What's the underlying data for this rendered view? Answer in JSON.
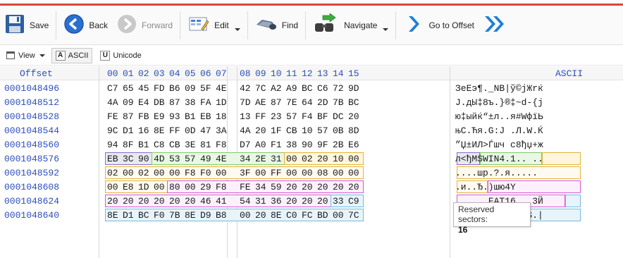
{
  "toolbar": {
    "save_label": "Save",
    "back_label": "Back",
    "forward_label": "Forward",
    "edit_label": "Edit",
    "find_label": "Find",
    "navigate_label": "Navigate",
    "goto_label": "Go to Offset"
  },
  "viewbar": {
    "view_label": "View",
    "ascii_badge": "A",
    "ascii_label": "ASCII",
    "unicode_badge": "U",
    "unicode_label": "Unicode"
  },
  "grid": {
    "offset_header": "Offset",
    "ascii_header": "ASCII",
    "columns": [
      "00",
      "01",
      "02",
      "03",
      "04",
      "05",
      "06",
      "07",
      "08",
      "09",
      "10",
      "11",
      "12",
      "13",
      "14",
      "15"
    ],
    "rows": [
      {
        "offset": "0001048496",
        "bytes": [
          "C7",
          "65",
          "45",
          "FD",
          "B6",
          "09",
          "5F",
          "4E",
          "42",
          "7C",
          "A2",
          "A9",
          "BC",
          "C6",
          "72",
          "9D"
        ],
        "ascii": "ЗeEэ¶._NB|ў©јЖrќ"
      },
      {
        "offset": "0001048512",
        "bytes": [
          "4A",
          "09",
          "E4",
          "DB",
          "87",
          "38",
          "FA",
          "1D",
          "7D",
          "AE",
          "87",
          "7E",
          "64",
          "2D",
          "7B",
          "BC"
        ],
        "ascii": "J.дЫ‡8ъ.}®‡~d-{ј"
      },
      {
        "offset": "0001048528",
        "bytes": [
          "FE",
          "87",
          "FB",
          "E9",
          "93",
          "B1",
          "EB",
          "18",
          "13",
          "FF",
          "23",
          "57",
          "F4",
          "BF",
          "DC",
          "20"
        ],
        "ascii": "ю‡ыйќ“±л..я#WфїЬ "
      },
      {
        "offset": "0001048544",
        "bytes": [
          "9C",
          "D1",
          "16",
          "8E",
          "FF",
          "0D",
          "47",
          "3A",
          "4A",
          "20",
          "1F",
          "CB",
          "10",
          "57",
          "0B",
          "8D"
        ],
        "ascii": "њС.Ћя.G:J .Л.W.Ќ"
      },
      {
        "offset": "0001048560",
        "bytes": [
          "94",
          "8F",
          "B1",
          "C8",
          "CB",
          "3E",
          "81",
          "F8",
          "D7",
          "A0",
          "F1",
          "38",
          "90",
          "9F",
          "2B",
          "E6"
        ],
        "ascii": "”Џ±ИЛ>Ѓшч с8ђџ+ж"
      },
      {
        "offset": "0001048576",
        "bytes": [
          "EB",
          "3C",
          "90",
          "4D",
          "53",
          "57",
          "49",
          "4E",
          "34",
          "2E",
          "31",
          "00",
          "02",
          "20",
          "10",
          "00"
        ],
        "ascii": "л<ђMSWIN4.1.. .."
      },
      {
        "offset": "0001048592",
        "bytes": [
          "02",
          "00",
          "02",
          "00",
          "00",
          "F8",
          "F0",
          "00",
          "3F",
          "00",
          "FF",
          "00",
          "00",
          "08",
          "00",
          "00"
        ],
        "ascii": "....шр.?.я....."
      },
      {
        "offset": "0001048608",
        "bytes": [
          "00",
          "E8",
          "1D",
          "00",
          "80",
          "00",
          "29",
          "F8",
          "FE",
          "34",
          "59",
          "20",
          "20",
          "20",
          "20",
          "20"
        ],
        "ascii": ".и..Ђ.)шю4Y"
      },
      {
        "offset": "0001048624",
        "bytes": [
          "20",
          "20",
          "20",
          "20",
          "20",
          "20",
          "46",
          "41",
          "54",
          "31",
          "36",
          "20",
          "20",
          "20",
          "33",
          "C9"
        ],
        "ascii": "      FAT16   3Й"
      },
      {
        "offset": "0001048640",
        "bytes": [
          "8E",
          "D1",
          "BC",
          "F0",
          "7B",
          "8E",
          "D9",
          "B8",
          "00",
          "20",
          "8E",
          "C0",
          "FC",
          "BD",
          "00",
          "7C"
        ],
        "ascii": "ЋСјр{ЋЩё. ЋАьЅ.|"
      }
    ]
  },
  "tooltip": {
    "title": "Reserved sectors:",
    "value": "16"
  },
  "colors": {
    "accent_red": "#d8463a",
    "offset_blue": "#2c4fb8",
    "hl_jump_fill": "#e8e8f0",
    "hl_jump_border": "#8e6ec8",
    "hl_oem_fill": "#e9f7e4",
    "hl_oem_border": "#7fcb6e",
    "hl_bps_fill": "#fff6dc",
    "hl_bps_border": "#e2b43a",
    "hl_pink_border": "#d55ad2",
    "hl_cyan_fill": "#e7f4fb",
    "hl_cyan_border": "#79b9df"
  }
}
